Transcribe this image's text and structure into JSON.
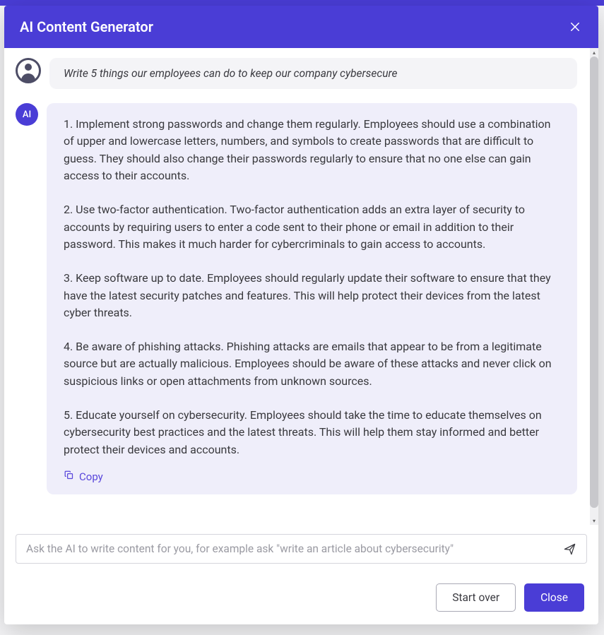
{
  "header": {
    "title": "AI Content Generator"
  },
  "conversation": {
    "user_prompt": "Write 5 things our employees can do to keep our company cybersecure",
    "ai_avatar_label": "AI",
    "ai_response": {
      "p1": "1. Implement strong passwords and change them regularly. Employees should use a combination of upper and lowercase letters, numbers, and symbols to create passwords that are difficult to guess. They should also change their passwords regularly to ensure that no one else can gain access to their accounts.",
      "p2": "2. Use two-factor authentication. Two-factor authentication adds an extra layer of security to accounts by requiring users to enter a code sent to their phone or email in addition to their password. This makes it much harder for cybercriminals to gain access to accounts.",
      "p3": "3. Keep software up to date. Employees should regularly update their software to ensure that they have the latest security patches and features. This will help protect their devices from the latest cyber threats.",
      "p4": "4. Be aware of phishing attacks. Phishing attacks are emails that appear to be from a legitimate source but are actually malicious. Employees should be aware of these attacks and never click on suspicious links or open attachments from unknown sources.",
      "p5": "5. Educate yourself on cybersecurity. Employees should take the time to educate themselves on cybersecurity best practices and the latest threats. This will help them stay informed and better protect their devices and accounts."
    },
    "copy_label": "Copy"
  },
  "input": {
    "placeholder": "Ask the AI to write content for you, for example ask \"write an article about cybersecurity\""
  },
  "footer": {
    "start_over_label": "Start over",
    "close_label": "Close"
  }
}
